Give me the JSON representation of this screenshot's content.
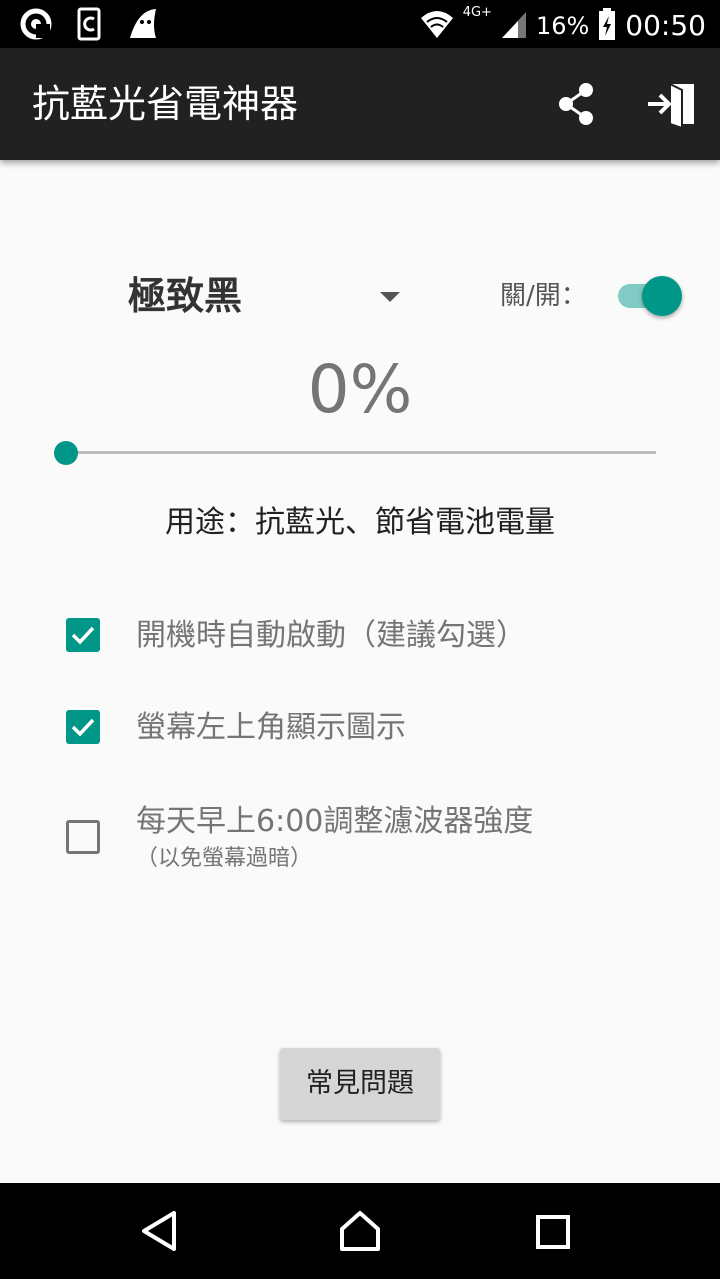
{
  "status_bar": {
    "network": "4G+",
    "battery": "16%",
    "time": "00:50",
    "left_icons": [
      "app-notification-icon",
      "clipboard-icon",
      "ghost-icon"
    ],
    "right_icons": [
      "wifi-icon",
      "signal-icon",
      "battery-charging-icon"
    ]
  },
  "app_bar": {
    "title": "抗藍光省電神器",
    "actions": [
      "share-icon",
      "exit-icon"
    ]
  },
  "mode": {
    "selected": "極致黑",
    "toggle_label": "關/開：",
    "toggle_on": true,
    "accent_color": "#009688"
  },
  "intensity": {
    "percent_label": "0%",
    "value_percent": 0
  },
  "usage_text": "用途：抗藍光、節省電池電量",
  "options": [
    {
      "label": "開機時自動啟動（建議勾選）",
      "checked": true
    },
    {
      "label": "螢幕左上角顯示圖示",
      "checked": true
    },
    {
      "label": "每天早上6:00調整濾波器強度",
      "sublabel": "（以免螢幕過暗）",
      "checked": false
    }
  ],
  "faq_button": "常見問題",
  "nav_bar": [
    "back-icon",
    "home-icon",
    "recents-icon"
  ]
}
